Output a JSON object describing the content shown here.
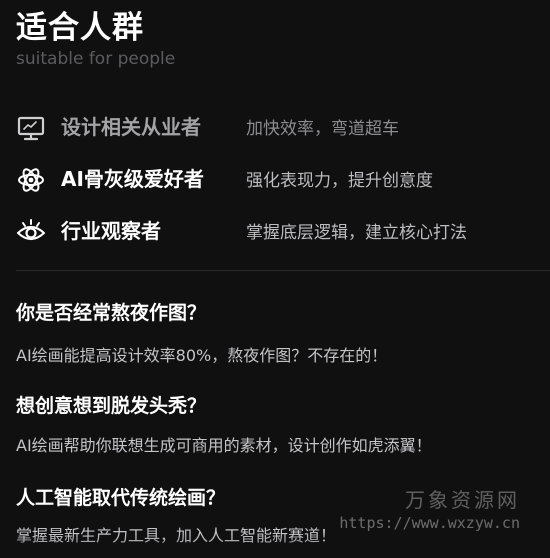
{
  "header": {
    "title": "适合人群",
    "subtitle": "suitable for people"
  },
  "audience": [
    {
      "icon": "monitor-icon",
      "label": "设计相关从业者",
      "desc": "加快效率，弯道超车"
    },
    {
      "icon": "atom-icon",
      "label": "AI骨灰级爱好者",
      "desc": "强化表现力，提升创意度"
    },
    {
      "icon": "eye-icon",
      "label": "行业观察者",
      "desc": "掌握底层逻辑，建立核心打法"
    }
  ],
  "faq": [
    {
      "q": "你是否经常熬夜作图？",
      "a": "AI绘画能提高设计效率80%，熬夜作图？不存在的！"
    },
    {
      "q": "想创意想到脱发头秃？",
      "a": "AI绘画帮助你联想生成可商用的素材，设计创作如虎添翼！"
    },
    {
      "q": "人工智能取代传统绘画？",
      "a": "掌握最新生产力工具，加入人工智能新赛道！"
    }
  ],
  "watermark": {
    "name": "万象资源网",
    "url": "https://www.wxzyw.cn"
  },
  "colors": {
    "background": "#101011",
    "text": "#ffffff",
    "muted": "#5c5c5f",
    "description": "#bdbdc0"
  }
}
